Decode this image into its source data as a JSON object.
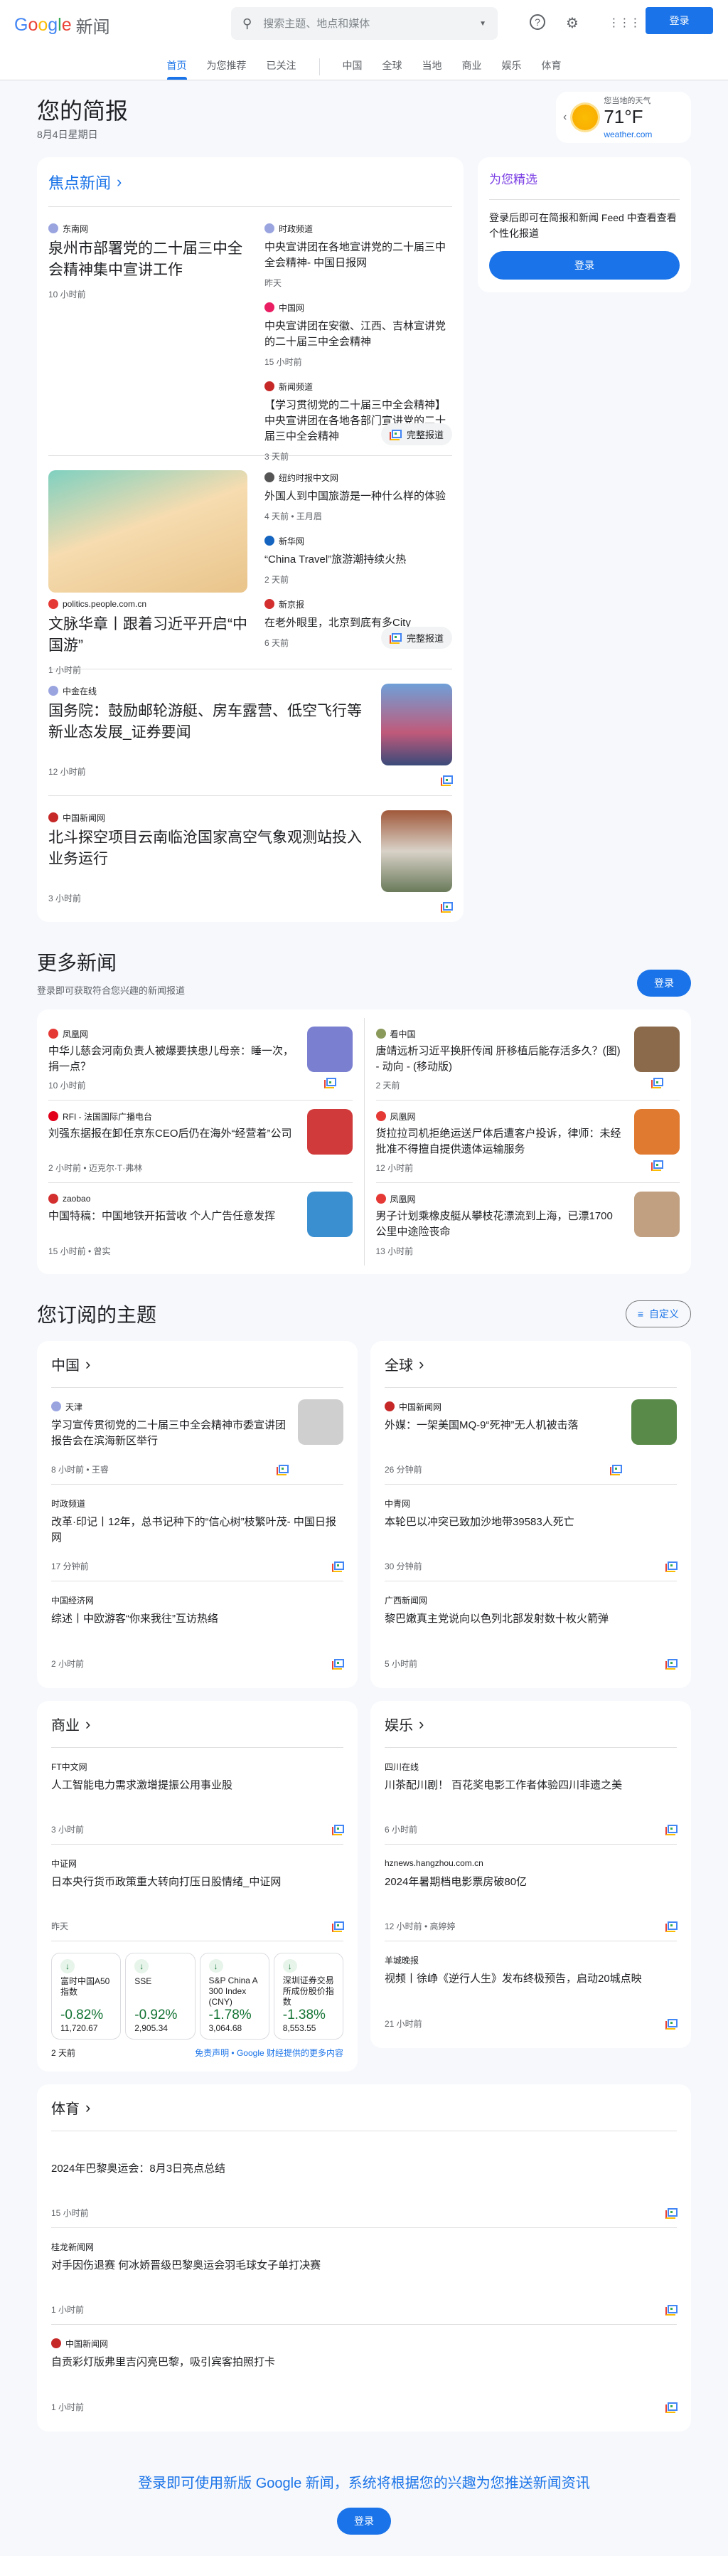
{
  "header": {
    "logo_google": "Google",
    "logo_product": "新闻",
    "search_placeholder": "搜索主题、地点和媒体",
    "login": "登录",
    "tabs": [
      {
        "label": "首页"
      },
      {
        "label": "为您推荐"
      },
      {
        "label": "已关注"
      },
      {
        "label": "中国"
      },
      {
        "label": "全球"
      },
      {
        "label": "当地"
      },
      {
        "label": "商业"
      },
      {
        "label": "娱乐"
      },
      {
        "label": "体育"
      }
    ]
  },
  "briefing": {
    "title": "您的简报",
    "date": "8月4日星期日"
  },
  "weather": {
    "label": "您当地的天气",
    "temp": "71°F",
    "source": "weather.com"
  },
  "top_stories": {
    "title": "焦点新闻",
    "full_coverage": "完整报道",
    "cluster1": {
      "main": {
        "source": "东南网",
        "title": "泉州市部署党的二十届三中全会精神集中宣讲工作",
        "time": "10 小时前"
      },
      "side": [
        {
          "source": "时政频道",
          "title": "中央宣讲团在各地宣讲党的二十届三中全会精神- 中国日报网",
          "time": "昨天"
        },
        {
          "source": "中国网",
          "title": "中央宣讲团在安徽、江西、吉林宣讲党的二十届三中全会精神",
          "time": "15 小时前"
        },
        {
          "source": "新闻频道",
          "title": "【学习贯彻党的二十届三中全会精神】中央宣讲团在各地各部门宣讲党的二十届三中全会精神",
          "time": "3 天前"
        }
      ]
    },
    "cluster2": {
      "main": {
        "source": "politics.people.com.cn",
        "title": "文脉华章丨跟着习近平开启“中国游”",
        "time": "1 小时前"
      },
      "side": [
        {
          "source": "纽约时报中文网",
          "title": "外国人到中国旅游是一种什么样的体验",
          "time": "4 天前 • 王月眉"
        },
        {
          "source": "新华网",
          "title": "“China Travel”旅游潮持续火热",
          "time": "2 天前"
        },
        {
          "source": "新京报",
          "title": "在老外眼里，北京到底有多City",
          "time": "6 天前"
        }
      ]
    },
    "cluster3": {
      "source": "中金在线",
      "title": "国务院：鼓励邮轮游艇、房车露营、低空飞行等新业态发展_证券要闻",
      "time": "12 小时前"
    },
    "cluster4": {
      "source": "中国新闻网",
      "title": "北斗探空项目云南临沧国家高空气象观测站投入业务运行",
      "time": "3 小时前"
    }
  },
  "for_you": {
    "title": "为您精选",
    "text": "登录后即可在简报和新闻 Feed 中查看查看个性化报道",
    "button": "登录"
  },
  "more_news": {
    "title": "更多新闻",
    "subtitle": "登录即可获取符合您兴趣的新闻报道",
    "button": "登录",
    "left": [
      {
        "source": "凤凰网",
        "title": "中华儿慈会河南负责人被爆要挟患儿母亲：睡一次，捐一点？",
        "time": "10 小时前",
        "fc": true,
        "color": "#e53935",
        "img": "#7a7fd0"
      },
      {
        "source": "RFI - 法国国际广播电台",
        "title": "刘强东据报在卸任京东CEO后仍在海外“经营着”公司",
        "time": "2 小时前 • 迈克尔·T·弗林",
        "fc": false,
        "color": "#e2001a",
        "img": "#d03a3a"
      },
      {
        "source": "zaobao",
        "title": "中国特稿：中国地铁开拓营收 个人广告任意发挥",
        "time": "15 小时前 • 曾实",
        "fc": false,
        "color": "#d32f2f",
        "img": "#3a8fd0"
      }
    ],
    "right": [
      {
        "source": "看中国",
        "title": "唐靖远析习近平换肝传闻 肝移植后能存活多久？(图) - 动向 - (移动版)",
        "time": "2 天前",
        "fc": true,
        "color": "#8a9a5b",
        "img": "#8a6a4a"
      },
      {
        "source": "凤凰网",
        "title": "货拉拉司机拒绝运送尸体后遭客户投诉，律师：未经批准不得擅自提供遗体运输服务",
        "time": "12 小时前",
        "fc": true,
        "color": "#e53935",
        "img": "#e07a30"
      },
      {
        "source": "凤凰网",
        "title": "男子计划乘橡皮艇从攀枝花漂流到上海，已漂1700公里中途险丧命",
        "time": "13 小时前",
        "fc": false,
        "color": "#e53935",
        "img": "#c0a080"
      }
    ]
  },
  "topics": {
    "title": "您订阅的主题",
    "customize": "自定义",
    "china": {
      "title": "中国",
      "articles": [
        {
          "source": "天津",
          "title": "学习宣传贯彻党的二十届三中全会精神市委宣讲团报告会在滨海新区举行",
          "time": "8 小时前 • 王睿",
          "img": "#cfcfcf"
        },
        {
          "source": "时政频道",
          "title": "改革·印记丨12年，总书记种下的“信心树”枝繁叶茂- 中国日报网",
          "time": "17 分钟前"
        },
        {
          "source": "中国经济网",
          "title": "综述丨中欧游客“你来我往”互访热络",
          "time": "2 小时前"
        }
      ]
    },
    "world": {
      "title": "全球",
      "articles": [
        {
          "source": "中国新闻网",
          "title": "外媒：一架美国MQ-9“死神”无人机被击落",
          "time": "26 分钟前",
          "img": "#5a8a4a"
        },
        {
          "source": "中青网",
          "title": "本轮巴以冲突已致加沙地带39583人死亡",
          "time": "30 分钟前"
        },
        {
          "source": "广西新闻网",
          "title": "黎巴嫩真主党说向以色列北部发射数十枚火箭弹",
          "time": "5 小时前"
        }
      ]
    },
    "business": {
      "title": "商业",
      "articles": [
        {
          "source": "FT中文网",
          "title": "人工智能电力需求激增提振公用事业股",
          "time": "3 小时前"
        },
        {
          "source": "中证网",
          "title": "日本央行货币政策重大转向打压日股情绪_中证网",
          "time": "昨天"
        }
      ],
      "stocks": [
        {
          "name": "富时中国A50指数",
          "change": "-0.82%",
          "value": "11,720.67"
        },
        {
          "name": "SSE",
          "change": "-0.92%",
          "value": "2,905.34"
        },
        {
          "name": "S&P China A 300 Index (CNY)",
          "change": "-1.78%",
          "value": "3,064.68"
        },
        {
          "name": "深圳证券交易所成份股价指数",
          "change": "-1.38%",
          "value": "8,553.55"
        }
      ],
      "stocks_time": "2 天前",
      "disclaimer": "免责声明 • Google 财经提供的更多内容"
    },
    "entertainment": {
      "title": "娱乐",
      "articles": [
        {
          "source": "四川在线",
          "title": "川茶配川剧！ 百花奖电影工作者体验四川非遗之美",
          "time": "6 小时前"
        },
        {
          "source": "hznews.hangzhou.com.cn",
          "title": "2024年暑期档电影票房破80亿",
          "time": "12 小时前 • 高婷婷"
        },
        {
          "source": "羊城晚报",
          "title": "视频丨徐峥《逆行人生》发布终极预告，启动20城点映",
          "time": "21 小时前"
        }
      ]
    },
    "sports": {
      "title": "体育",
      "articles": [
        {
          "source": "",
          "title": "2024年巴黎奥运会：8月3日亮点总结",
          "time": "15 小时前"
        },
        {
          "source": "桂龙新闻网",
          "title": "对手因伤退赛 何冰娇晋级巴黎奥运会羽毛球女子单打决赛",
          "time": "1 小时前"
        },
        {
          "source": "中国新闻网",
          "title": "自贡彩灯版弗里吉闪亮巴黎，吸引宾客拍照打卡",
          "time": "1 小时前"
        }
      ]
    }
  },
  "footer": {
    "message": "登录即可使用新版 Google 新闻，系统将根据您的兴趣为您推送新闻资讯",
    "button": "登录"
  }
}
